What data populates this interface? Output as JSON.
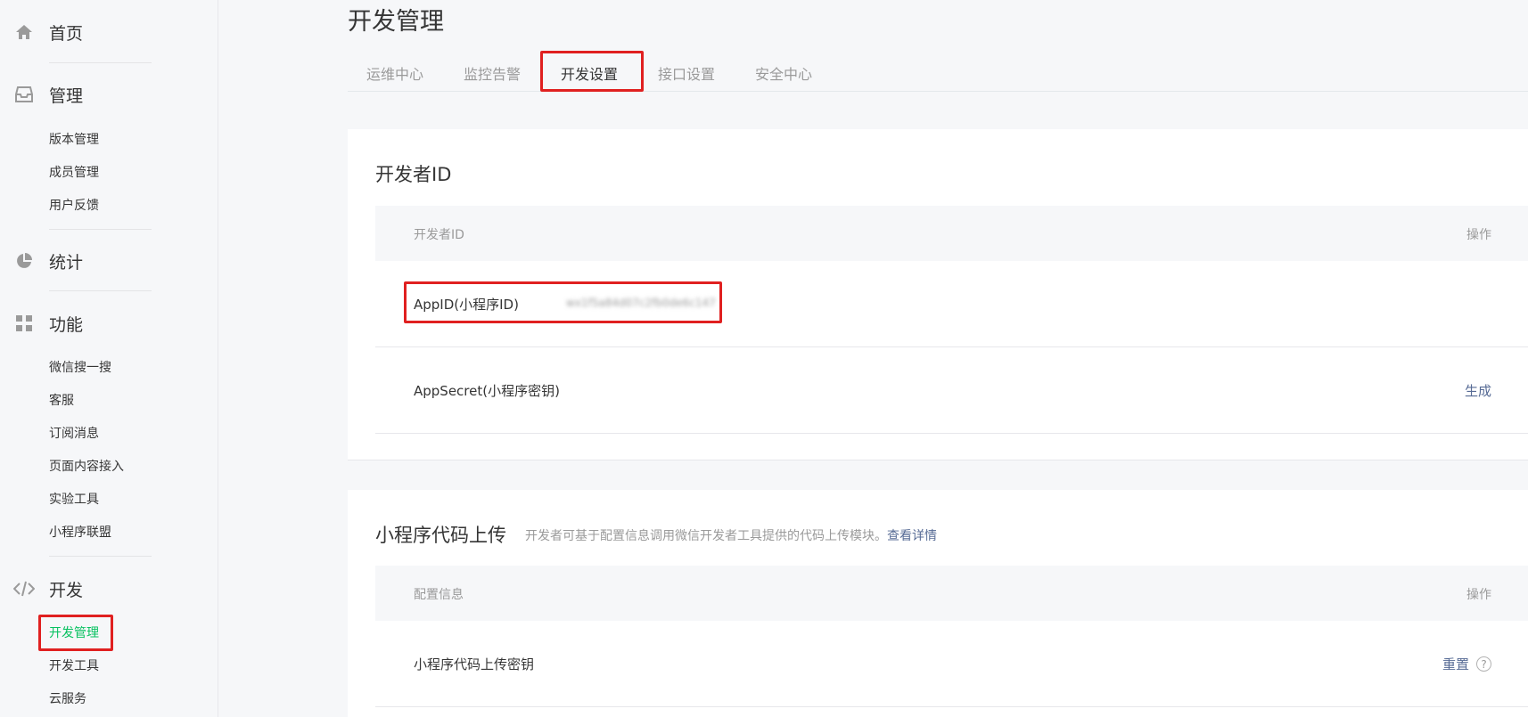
{
  "sidebar": {
    "home": {
      "label": "首页",
      "icon": "home-icon"
    },
    "manage": {
      "label": "管理",
      "icon": "inbox-icon",
      "items": [
        "版本管理",
        "成员管理",
        "用户反馈"
      ]
    },
    "stats": {
      "label": "统计",
      "icon": "pie-chart-icon"
    },
    "features": {
      "label": "功能",
      "icon": "grid-icon",
      "items": [
        "微信搜一搜",
        "客服",
        "订阅消息",
        "页面内容接入",
        "实验工具",
        "小程序联盟"
      ]
    },
    "develop": {
      "label": "开发",
      "icon": "code-icon",
      "items": [
        "开发管理",
        "开发工具",
        "云服务"
      ],
      "active_item": "开发管理"
    }
  },
  "page": {
    "title": "开发管理"
  },
  "tabs": {
    "items": [
      "运维中心",
      "监控告警",
      "开发设置",
      "接口设置",
      "安全中心"
    ],
    "active": "开发设置"
  },
  "developer_id_card": {
    "title": "开发者ID",
    "header": {
      "col1": "开发者ID",
      "col2": "操作"
    },
    "rows": [
      {
        "label": "AppID(小程序ID)",
        "value": "wx1f5a84d07c2fb0de6c147",
        "action": ""
      },
      {
        "label": "AppSecret(小程序密钥)",
        "value": "",
        "action": "生成"
      }
    ]
  },
  "upload_card": {
    "title": "小程序代码上传",
    "desc": "开发者可基于配置信息调用微信开发者工具提供的代码上传模块。",
    "desc_link": "查看详情",
    "header": {
      "col1": "配置信息",
      "col2": "操作"
    },
    "rows": [
      {
        "label": "小程序代码上传密钥",
        "action": "重置",
        "help": "?"
      }
    ]
  },
  "colors": {
    "accent": "#07c160",
    "link": "#576b95",
    "highlight_box": "#e02020"
  }
}
